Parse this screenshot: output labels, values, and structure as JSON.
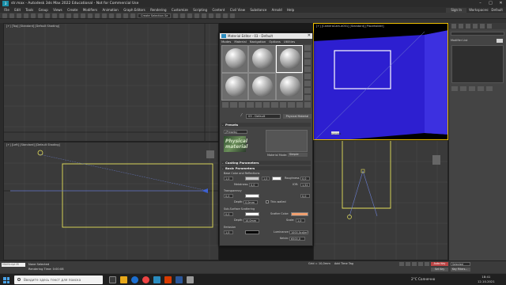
{
  "window": {
    "title": "str.max - Autodesk 3ds Max 2022 Educational - Not for Commercial Use",
    "logo": "3",
    "buttons": [
      "minimize-icon",
      "maximize-icon",
      "close-icon"
    ]
  },
  "menu": {
    "items": [
      "File",
      "Edit",
      "Tools",
      "Group",
      "Views",
      "Create",
      "Modifiers",
      "Animation",
      "Graph Editors",
      "Rendering",
      "Customize",
      "Scripting",
      "Content",
      "Civil View",
      "Substance",
      "Arnold",
      "Help"
    ],
    "sign_in": "Sign In",
    "workspaces_label": "Workspaces:",
    "workspaces_value": "Default"
  },
  "toolbar": {
    "selection_set": "Create Selection Se"
  },
  "viewports": {
    "top_left": "[+] [Top] [Standard] [Default Shading]",
    "top_right": "[+] [CameraCam-d001] [Standard] [Placeholder]",
    "left": "[+] [Left] [Standard] [Default Shading]",
    "label_cam": "Cam001"
  },
  "right_panel": {
    "object_name": "Rectangle001",
    "modifier_list": "Modifier List"
  },
  "material_editor": {
    "title": "Material Editor - 03 - Default",
    "menu": [
      "Modes",
      "Material",
      "Navigation",
      "Options",
      "Utilities"
    ],
    "material_name": "03 - Default",
    "material_type": "Physical Material",
    "presets_title": "Presets",
    "presets_value": "(Presets)",
    "presets_image_text": "Physical material",
    "material_mode_label": "Material Mode:",
    "material_mode_value": "Simple",
    "coating_title": "Coating Parameters",
    "basic_title": "Basic Parameters",
    "base_color_reflections": "Base Color and Reflections",
    "base_weight": "1,0",
    "roughness_label": "Roughness",
    "roughness_value": "0,0",
    "metalness_label": "Metalness:",
    "metalness_value": "0,0",
    "ior_label": "IOR:",
    "ior_value": "1,52",
    "reflection_weight": "1,0",
    "transparency_label": "Transparency",
    "transparency_weight": "0,0",
    "trans_roughness": "0,0",
    "depth_label": "Depth:",
    "depth_value": "0,0mm",
    "thin_walled_label": "Thin-walled",
    "sss_label": "Sub-Surface Scattering",
    "sss_weight": "0,0",
    "scatter_color_label": "Scatter Color:",
    "sss_depth_label": "Depth:",
    "sss_depth_value": "10,0mm",
    "scale_label": "Scale:",
    "scale_value": "1,0",
    "emission_label": "Emission",
    "emission_weight": "1,0",
    "luminance_label": "Luminance:",
    "luminance_value": "1000,0cd/m²",
    "kelvin_label": "Kelvin:",
    "kelvin_value": "6500,0"
  },
  "status": {
    "maxscript": "MAXScript Mi",
    "line1": "None Selected",
    "line2": "Rendering Time: 0:00:08",
    "grid": "Grid = 10,0mm",
    "add_time_tag": "Add Time Tag",
    "auto_key": "Auto Key",
    "set_key": "Set Key",
    "selected": "Selected",
    "key_filters": "Key Filters..."
  },
  "taskbar": {
    "search_placeholder": "Введите здесь текст для поиска",
    "weather": "2°C  Солнечно",
    "time": "18:41",
    "date": "12.10.2021"
  },
  "colors": {
    "accent": "#2a8cbf",
    "viewport_bg": "#3a3a3a",
    "shape_yellow": "#e5e05a",
    "wall_blue": "#2d1fd0",
    "scatter_color": "#f0a070",
    "auto_key_red": "#b44444"
  }
}
